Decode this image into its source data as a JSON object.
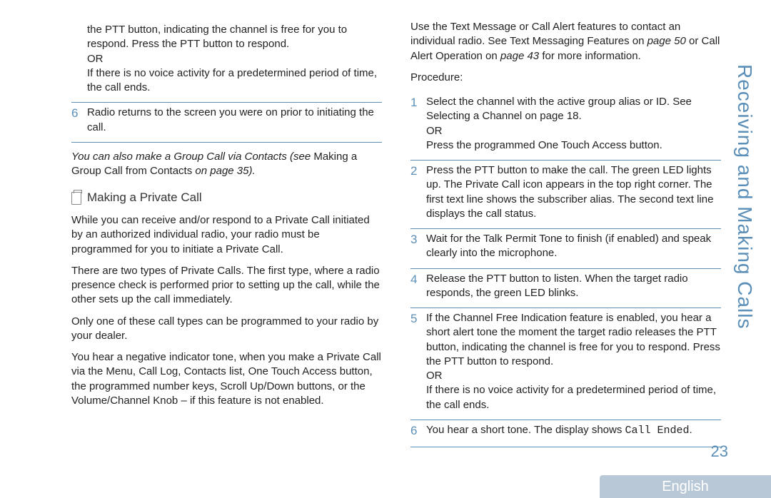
{
  "sideTitle": "Receiving and Making Calls",
  "pageNumber": "23",
  "language": "English",
  "left": {
    "preText1": "the PTT button, indicating the channel is free for you to respond. Press the PTT button to respond.",
    "preOr": "OR",
    "preText2": "If there is no voice activity for a predetermined period of time, the call ends.",
    "step6Num": "6",
    "step6": "Radio returns to the screen you were on prior to initiating the call.",
    "noteA": "You can also make a Group Call via Contacts (see ",
    "noteB": "Making a Group Call from Contacts",
    "noteC": " on page 35",
    "noteD": ").",
    "heading": "Making a Private Call",
    "p1": "While you can receive and/or respond to a Private Call initiated by an authorized individual radio, your radio must be programmed for you to initiate a Private Call.",
    "p2": "There are two types of Private Calls. The first type, where a radio presence check is performed prior to setting up the call, while the other sets up the call immediately.",
    "p3a": "Only ",
    "p3b": "one",
    "p3c": " of these call types can be programmed to your radio by your dealer.",
    "p4": "You hear a negative indicator tone, when you make a Private Call via the Menu, Call Log, Contacts list, One Touch Access button, the programmed number keys, Scroll Up/Down buttons, or the Volume/Channel Knob – if this feature is not enabled."
  },
  "right": {
    "introA": "Use the Text Message or Call Alert features to contact an individual radio. See ",
    "introB": "Text Messaging Features",
    "introC": " on ",
    "introD": "page 50",
    "introE": " or ",
    "introF": "Call Alert Operation",
    "introG": " on ",
    "introH": "page 43",
    "introI": " for more information.",
    "procLabel": "Procedure:",
    "s1n": "1",
    "s1a": "Select the channel with the active group alias or ID. See ",
    "s1b": "Selecting a Channel",
    "s1c": " on page 18.",
    "s1or": "OR",
    "s1d": "Press the programmed ",
    "s1e": "One Touch Access",
    "s1f": " button.",
    "s2n": "2",
    "s2": "Press the PTT button to make the call. The green LED lights up. The Private Call icon appears in the top right corner. The first text line shows the subscriber alias. The second text line displays the call status.",
    "s3n": "3",
    "s3": "Wait for the Talk Permit Tone to finish (if enabled) and speak clearly into the microphone.",
    "s4n": "4",
    "s4": "Release the PTT button to listen. When the target radio responds, the green LED blinks.",
    "s5n": "5",
    "s5a": "If the Channel Free Indication feature is enabled, you hear a short alert tone the moment the target radio releases the PTT button, indicating the channel is free for you to respond. Press the PTT button to respond.",
    "s5or": "OR",
    "s5b": "If there is no voice activity for a predetermined period of time, the call ends.",
    "s6n": "6",
    "s6a": "You hear a short tone. The display shows ",
    "s6b": "Call Ended",
    "s6c": "."
  }
}
